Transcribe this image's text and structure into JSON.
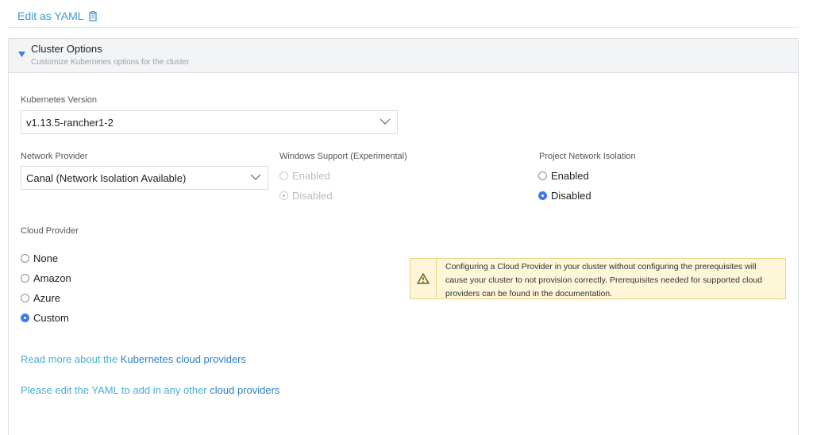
{
  "edit_yaml": {
    "label": "Edit as YAML",
    "icon": "clipboard-icon"
  },
  "panel": {
    "title": "Cluster Options",
    "subtitle": "Customize Kubernetes options for the cluster"
  },
  "kubernetes_version": {
    "label": "Kubernetes Version",
    "value": "v1.13.5-rancher1-2"
  },
  "network_provider": {
    "label": "Network Provider",
    "value": "Canal (Network Isolation Available)"
  },
  "windows_support": {
    "label": "Windows Support (Experimental)",
    "options": [
      "Enabled",
      "Disabled"
    ],
    "selected": "Disabled"
  },
  "project_network_isolation": {
    "label": "Project Network Isolation",
    "options": [
      "Enabled",
      "Disabled"
    ],
    "selected": "Disabled"
  },
  "cloud_provider": {
    "label": "Cloud Provider",
    "options": [
      "None",
      "Amazon",
      "Azure",
      "Custom"
    ],
    "selected": "Custom"
  },
  "warning": {
    "text": "Configuring a Cloud Provider in your cluster without configuring the prerequisites will cause your cluster to not provision correctly. Prerequisites needed for supported cloud providers can be found in the documentation."
  },
  "info1": {
    "prefix": "Read more about the ",
    "link": "Kubernetes cloud providers"
  },
  "info2": {
    "prefix": "Please edit the YAML to add in any other ",
    "link": "cloud providers"
  },
  "colors": {
    "accent": "#3d98d3",
    "radio_checked": "#3d7be8",
    "warning_bg": "#fdf6d8",
    "warning_border": "#ecd27c"
  }
}
